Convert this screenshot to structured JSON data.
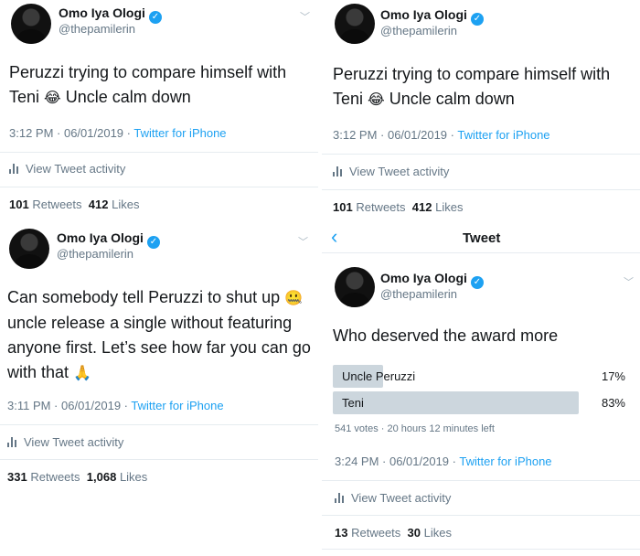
{
  "author": {
    "name": "Omo Iya Ologi",
    "handle": "@thepamilerin",
    "verified_mark": "✓"
  },
  "tweet1": {
    "line1": "Peruzzi trying to compare himself with",
    "line2a": "Teni",
    "line2b": "Uncle calm down",
    "emoji": "😂",
    "time": "3:12 PM · 06/01/2019 ·",
    "source": "Twitter for iPhone",
    "activity": "View Tweet activity",
    "retweets": "101",
    "retweets_label": "Retweets",
    "likes": "412",
    "likes_label": "Likes"
  },
  "tweet2": {
    "line1": "Can somebody tell Peruzzi to shut up",
    "emoji1": "🤐",
    "line2": "uncle release a single without featuring",
    "line3": "anyone first. Let’s see how far you can go",
    "line4": "with that",
    "emoji2": "🙏",
    "time": "3:11 PM · 06/01/2019 ·",
    "source": "Twitter for iPhone",
    "activity": "View Tweet activity",
    "retweets": "331",
    "retweets_label": "Retweets",
    "likes": "1,068",
    "likes_label": "Likes"
  },
  "nav": {
    "back": "‹",
    "title": "Tweet"
  },
  "tweet3": {
    "text": "Who deserved the award more",
    "poll": [
      {
        "label": "Uncle Peruzzi",
        "percent_text": "17%",
        "share": 0.17
      },
      {
        "label": "Teni",
        "percent_text": "83%",
        "share": 0.83
      }
    ],
    "poll_meta": "541 votes · 20 hours 12 minutes left",
    "time": "3:24 PM · 06/01/2019 ·",
    "source": "Twitter for iPhone",
    "activity": "View Tweet activity",
    "retweets": "13",
    "retweets_label": "Retweets",
    "likes": "30",
    "likes_label": "Likes"
  },
  "icons": {
    "chevron": "﹀"
  },
  "colors": {
    "link": "#1da1f2",
    "muted": "#657786",
    "poll_bar": "#ccd6dd"
  }
}
